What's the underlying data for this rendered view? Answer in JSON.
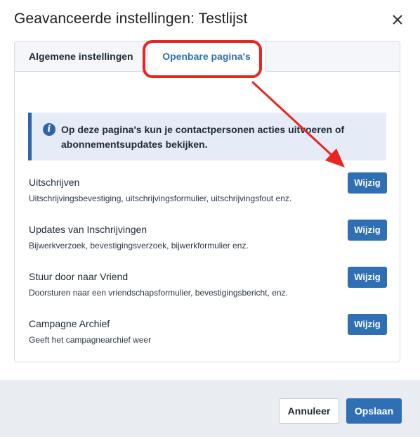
{
  "dialog": {
    "title": "Geavanceerde instellingen: Testlijst",
    "close_icon": "close-icon"
  },
  "tabs": [
    {
      "label": "Algemene instellingen",
      "active": false
    },
    {
      "label": "Openbare pagina's",
      "active": true
    }
  ],
  "info": {
    "icon": "info-icon",
    "text": "Op deze pagina's kun je contactpersonen acties uitvoeren of abonnementsupdates bekijken."
  },
  "pages": [
    {
      "title": "Uitschrijven",
      "description": "Uitschrijvingsbevestiging, uitschrijvingsformulier, uitschrijvingsfout enz.",
      "button": "Wijzig"
    },
    {
      "title": "Updates van Inschrijvingen",
      "description": "Bijwerkverzoek, bevestigingsverzoek, bijwerkformulier enz.",
      "button": "Wijzig"
    },
    {
      "title": "Stuur door naar Vriend",
      "description": "Doorsturen naar een vriendschapsformulier, bevestigingsbericht, enz.",
      "button": "Wijzig"
    },
    {
      "title": "Campagne Archief",
      "description": "Geeft het campagnearchief weer",
      "button": "Wijzig"
    }
  ],
  "footer": {
    "cancel_label": "Annuleer",
    "save_label": "Opslaan"
  },
  "colors": {
    "primary": "#2f6fb3",
    "annotation": "#e8261f",
    "info_background": "#e6ecf7"
  }
}
